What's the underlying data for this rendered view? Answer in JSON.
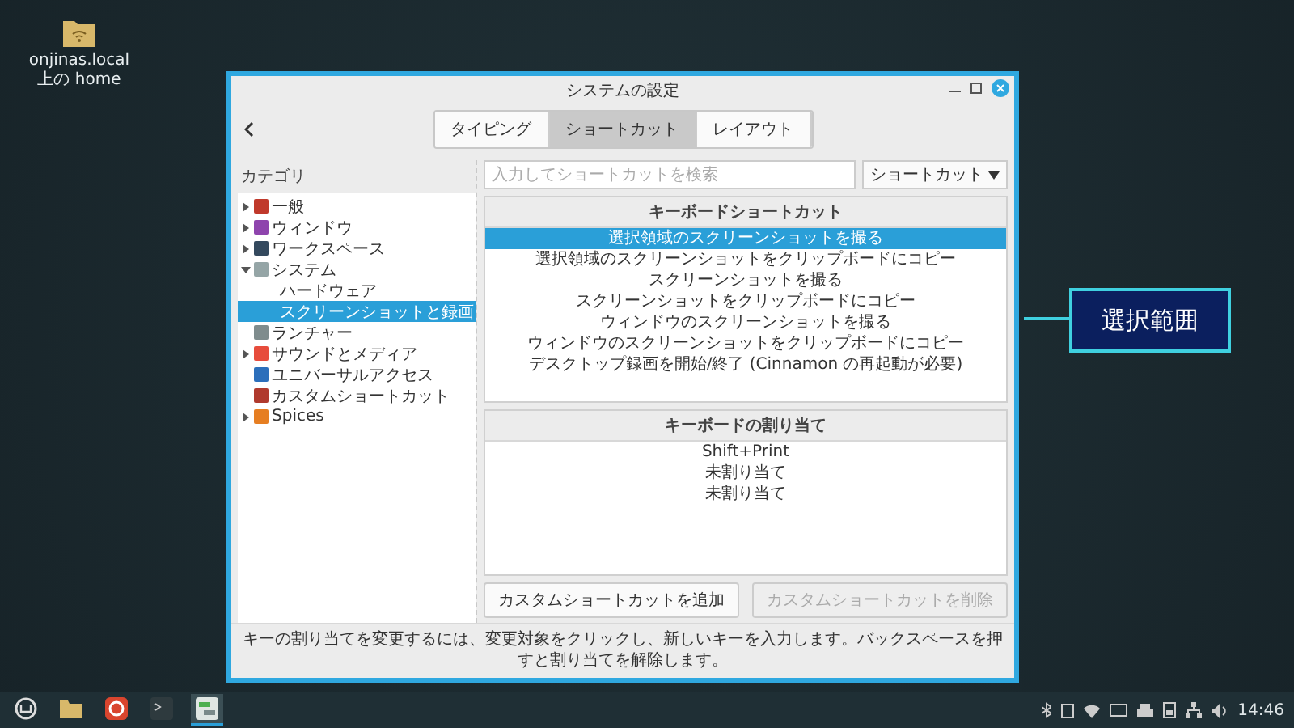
{
  "desktop_icons": [
    {
      "label": "onjinas.local 上の home"
    }
  ],
  "window": {
    "title": "システムの設定",
    "tabs": [
      {
        "label": "タイピング",
        "selected": false
      },
      {
        "label": "ショートカット",
        "selected": true
      },
      {
        "label": "レイアウト",
        "selected": false
      }
    ],
    "sidebar": {
      "header": "カテゴリ",
      "items": [
        {
          "label": "一般",
          "expanded": false,
          "color": "#c0392b",
          "selected": false
        },
        {
          "label": "ウィンドウ",
          "expanded": false,
          "color": "#8e44ad",
          "selected": false
        },
        {
          "label": "ワークスペース",
          "expanded": false,
          "color": "#34495e",
          "selected": false
        },
        {
          "label": "システム",
          "expanded": true,
          "color": "#95a5a6",
          "selected": false,
          "children": [
            {
              "label": "ハードウェア",
              "selected": false
            },
            {
              "label": "スクリーンショットと録画",
              "selected": true
            }
          ]
        },
        {
          "label": "ランチャー",
          "color": "#7f8c8d",
          "selected": false
        },
        {
          "label": "サウンドとメディア",
          "expanded": false,
          "color": "#e74c3c",
          "selected": false
        },
        {
          "label": "ユニバーサルアクセス",
          "color": "#2c6fbb",
          "selected": false
        },
        {
          "label": "カスタムショートカット",
          "color": "#b03a2e",
          "selected": false
        },
        {
          "label": "Spices",
          "expanded": false,
          "color": "#e67e22",
          "selected": false
        }
      ]
    },
    "search": {
      "placeholder": "入力してショートカットを検索"
    },
    "filter_dropdown": "ショートカット",
    "shortcuts": {
      "header": "キーボードショートカット",
      "rows": [
        {
          "label": "選択領域のスクリーンショットを撮る",
          "selected": true
        },
        {
          "label": "選択領域のスクリーンショットをクリップボードにコピー",
          "selected": false
        },
        {
          "label": "スクリーンショットを撮る",
          "selected": false
        },
        {
          "label": "スクリーンショットをクリップボードにコピー",
          "selected": false
        },
        {
          "label": "ウィンドウのスクリーンショットを撮る",
          "selected": false
        },
        {
          "label": "ウィンドウのスクリーンショットをクリップボードにコピー",
          "selected": false
        },
        {
          "label": "デスクトップ録画を開始/終了 (Cinnamon の再起動が必要)",
          "selected": false
        }
      ]
    },
    "bindings": {
      "header": "キーボードの割り当て",
      "rows": [
        "Shift+Print",
        "未割り当て",
        "未割り当て"
      ]
    },
    "buttons": [
      {
        "label": "カスタムショートカットを追加",
        "disabled": false
      },
      {
        "label": "カスタムショートカットを削除",
        "disabled": true
      }
    ],
    "hint": "キーの割り当てを変更するには、変更対象をクリックし、新しいキーを入力します。バックスペースを押すと割り当てを解除します。"
  },
  "callout": {
    "label": "選択範囲"
  },
  "taskbar": {
    "apps": [
      {
        "kind": "menu",
        "selected": false
      },
      {
        "kind": "folder",
        "selected": false
      },
      {
        "kind": "browser",
        "selected": false
      },
      {
        "kind": "terminal",
        "selected": false
      },
      {
        "kind": "settings",
        "selected": true
      }
    ],
    "clock": "14:46"
  }
}
